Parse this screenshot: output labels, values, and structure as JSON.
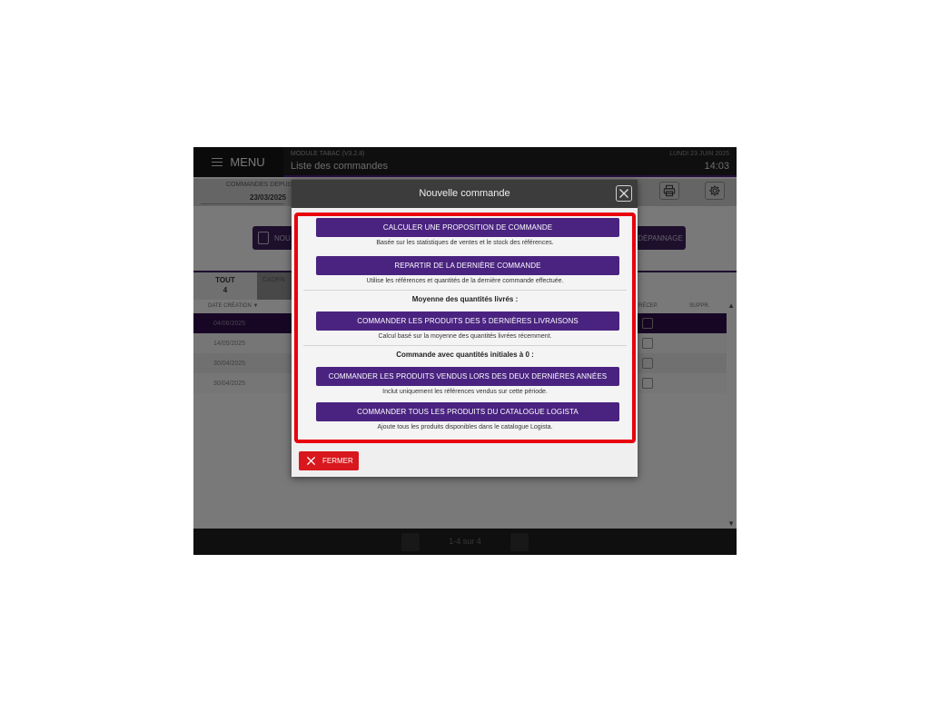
{
  "header": {
    "menu_label": "MENU",
    "module": "MODULE TABAC (V3.2.8)",
    "title": "Liste des commandes",
    "date": "LUNDI 23 JUIN 2025",
    "time": "14:03"
  },
  "filter": {
    "label": "COMMANDES DEPUIS",
    "date": "23/03/2025"
  },
  "background_actions": {
    "new_label": "NOU",
    "depannage_label": "DÉPANNAGE"
  },
  "tabs": [
    {
      "label": "TOUT",
      "count": "4"
    },
    {
      "label": "CADEN"
    }
  ],
  "table": {
    "col_date": "DATE CRÉATION ▼",
    "col_recep": "RÉCEP.",
    "col_suppr": "SUPPR.",
    "rows": [
      {
        "date": "04/06/2025"
      },
      {
        "date": "14/05/2025"
      },
      {
        "date": "30/04/2025"
      },
      {
        "date": "30/04/2025"
      }
    ]
  },
  "footer": {
    "pagination": "1-4 sur 4"
  },
  "modal": {
    "title": "Nouvelle commande",
    "options": [
      {
        "label": "CALCULER UNE PROPOSITION DE COMMANDE",
        "desc": "Basée sur les statistiques de ventes et le stock des références."
      },
      {
        "label": "REPARTIR DE LA DERNIÈRE COMMANDE",
        "desc": "Utilise les références et quantités de la dernière commande effectuée."
      }
    ],
    "section_avg": "Moyenne des quantités livrés :",
    "avg_option": {
      "label": "COMMANDER LES PRODUITS DES 5 DERNIÈRES LIVRAISONS",
      "desc": "Calcul basé sur la moyenne des quantités livrées récemment."
    },
    "section_zero": "Commande avec quantités initiales à 0 :",
    "zero_options": [
      {
        "label": "COMMANDER LES PRODUITS VENDUS LORS DES DEUX DERNIÈRES ANNÉES",
        "desc": "Inclut uniquement les références vendus sur cette période."
      },
      {
        "label": "COMMANDER TOUS LES PRODUITS DU CATALOGUE LOGISTA",
        "desc": "Ajoute tous les produits disponibles dans le catalogue Logista."
      }
    ],
    "close_label": "FERMER"
  },
  "colors": {
    "accent": "#4a2380",
    "highlight_border": "#e8000d",
    "close_button": "#d8181d"
  }
}
